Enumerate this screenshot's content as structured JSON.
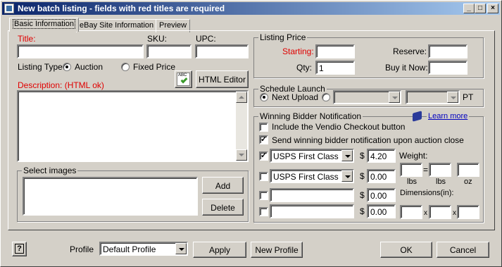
{
  "window": {
    "title": "New batch listing - fields with red titles are required",
    "min_glyph": "_",
    "max_glyph": "□",
    "close_glyph": "×"
  },
  "tabs": [
    "Basic Information",
    "eBay Site Information",
    "Preview"
  ],
  "basic": {
    "title_label": "Title:",
    "sku_label": "SKU:",
    "upc_label": "UPC:",
    "title_value": "",
    "sku_value": "",
    "upc_value": "",
    "listing_type_label": "Listing Type:",
    "auction_label": "Auction",
    "fixed_price_label": "Fixed Price",
    "listing_type_selected": "Auction",
    "spellcheck_text": "ABC",
    "html_editor_label": "HTML Editor",
    "description_label": "Description: (HTML ok)",
    "description_value": ""
  },
  "images": {
    "legend": "Select images",
    "add_label": "Add",
    "delete_label": "Delete"
  },
  "listing_price": {
    "legend": "Listing Price",
    "starting_label": "Starting:",
    "starting_value": "",
    "reserve_label": "Reserve:",
    "reserve_value": "",
    "qty_label": "Qty:",
    "qty_value": "1",
    "buy_it_now_label": "Buy it Now:",
    "buy_it_now_value": ""
  },
  "schedule": {
    "legend": "Schedule Launch",
    "next_upload_label": "Next Upload",
    "selected": "Next Upload",
    "date_value": "",
    "time_value": "",
    "tz_label": "PT"
  },
  "winning": {
    "legend": "Winning Bidder Notification",
    "learn_more_label": "Learn more",
    "include_checkout_label": "Include the Vendio Checkout button",
    "include_checkout_checked": false,
    "send_notification_label": "Send winning bidder notification upon auction close",
    "send_notification_checked": true,
    "shipping_rows": [
      {
        "checked": true,
        "service": "USPS First Class",
        "currency": "$",
        "amount": "4.20"
      },
      {
        "checked": false,
        "service": "USPS First Class",
        "currency": "$",
        "amount": "0.00"
      },
      {
        "checked": false,
        "service": "",
        "currency": "$",
        "amount": "0.00"
      },
      {
        "checked": false,
        "service": "",
        "currency": "$",
        "amount": "0.00"
      }
    ],
    "weight_label": "Weight:",
    "weight_lbs_value": "",
    "weight_oz_value": "",
    "weight_sep": "=",
    "lbs_label_1": "lbs",
    "lbs_label_2": "lbs",
    "oz_label": "oz",
    "dimensions_label": "Dimensions(in):",
    "dim_sep": "x",
    "dim_values": [
      "",
      "",
      ""
    ]
  },
  "footer": {
    "help_glyph": "?",
    "profile_label": "Profile",
    "profile_value": "Default Profile",
    "apply_label": "Apply",
    "new_profile_label": "New Profile",
    "ok_label": "OK",
    "cancel_label": "Cancel"
  },
  "colors": {
    "required": "#e00000",
    "window_bg": "#d4d0c8",
    "titlebar_start": "#0a246a",
    "titlebar_end": "#a6caf0",
    "link": "#0000c0"
  }
}
